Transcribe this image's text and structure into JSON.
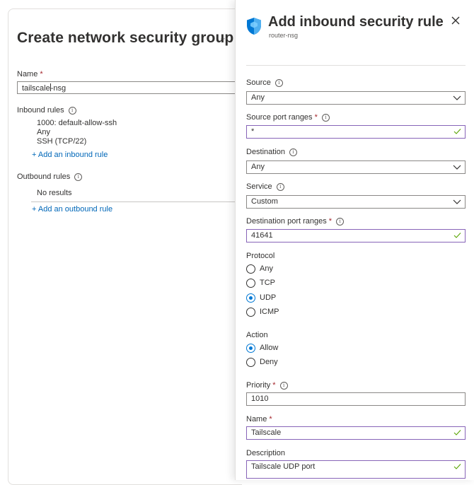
{
  "left_blade": {
    "title": "Create network security group",
    "more": "···",
    "name_label": "Name",
    "required_mark": "*",
    "name_value_before_cursor": "tailscale",
    "name_value_after_cursor": "-nsg",
    "inbound_label": "Inbound rules",
    "inbound_rule": {
      "line1": "1000: default-allow-ssh",
      "line2": "Any",
      "line3": "SSH (TCP/22)"
    },
    "add_inbound": "+ Add an inbound rule",
    "outbound_label": "Outbound rules",
    "outbound_empty": "No results",
    "add_outbound": "+ Add an outbound rule"
  },
  "panel": {
    "title": "Add inbound security rule",
    "subtitle": "router-nsg",
    "close_icon": "close-icon",
    "source": {
      "label": "Source",
      "value": "Any"
    },
    "source_port": {
      "label": "Source port ranges",
      "value": "*"
    },
    "destination": {
      "label": "Destination",
      "value": "Any"
    },
    "service": {
      "label": "Service",
      "value": "Custom"
    },
    "dest_port": {
      "label": "Destination port ranges",
      "value": "41641"
    },
    "protocol": {
      "label": "Protocol",
      "options": [
        "Any",
        "TCP",
        "UDP",
        "ICMP"
      ],
      "selected": "UDP"
    },
    "action": {
      "label": "Action",
      "options": [
        "Allow",
        "Deny"
      ],
      "selected": "Allow"
    },
    "priority": {
      "label": "Priority",
      "value": "1010"
    },
    "name": {
      "label": "Name",
      "value": "Tailscale"
    },
    "description": {
      "label": "Description",
      "value": "Tailscale UDP port"
    }
  },
  "colors": {
    "accent": "#0078d4",
    "link": "#0067b8",
    "required": "#a4262c",
    "valid_border": "#8764b8",
    "valid_check": "#57a300"
  }
}
